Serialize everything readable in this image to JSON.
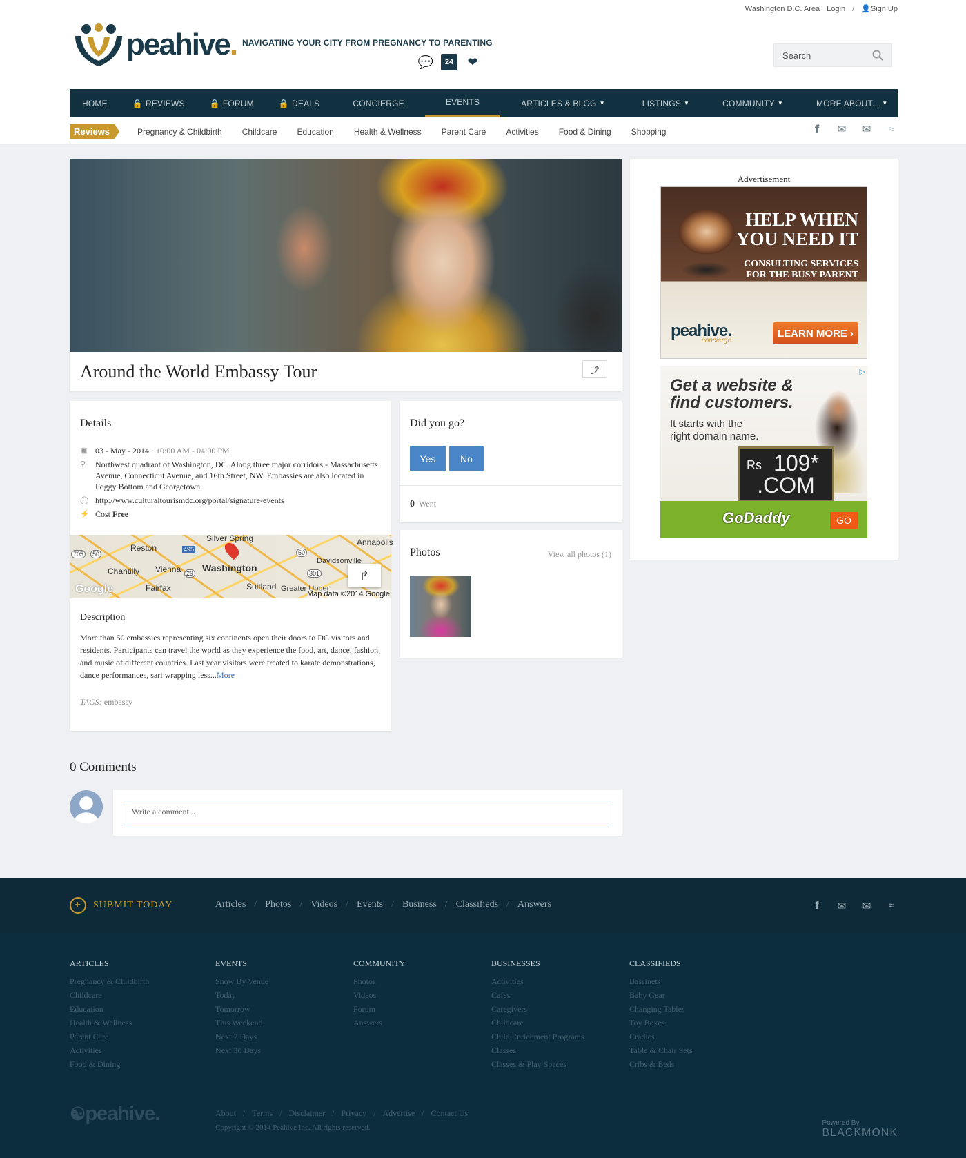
{
  "topbar": {
    "region": "Washington D.C. Area",
    "login": "Login",
    "separator": "/",
    "signup": "Sign Up"
  },
  "brand": {
    "name": "peahive",
    "dot": ".",
    "tagline": "NAVIGATING YOUR CITY FROM PREGNANCY TO PARENTING",
    "calendar_day": "24"
  },
  "search": {
    "placeholder": "Search"
  },
  "nav": {
    "home": "HOME",
    "reviews": "REVIEWS",
    "forum": "FORUM",
    "deals": "DEALS",
    "concierge": "CONCIERGE",
    "events": "EVENTS",
    "articles": "ARTICLES & BLOG",
    "listings": "LISTINGS",
    "community": "COMMUNITY",
    "more": "MORE ABOUT..."
  },
  "subnav": {
    "badge": "Reviews",
    "items": [
      "Pregnancy & Childbirth",
      "Childcare",
      "Education",
      "Health & Wellness",
      "Parent Care",
      "Activities",
      "Food & Dining",
      "Shopping"
    ]
  },
  "event": {
    "title": "Around the World Embassy Tour",
    "details_heading": "Details",
    "date": "03 - May - 2014",
    "date_sep": "·",
    "time": "10:00 AM - 04:00 PM",
    "location": "Northwest quadrant of Washington, DC. Along three major corridors - Massachusetts Avenue, Connecticut Avenue, and 16th Street, NW. Embassies are also located in Foggy Bottom and Georgetown",
    "url": "http://www.culturaltourismdc.org/portal/signature-events",
    "cost_label": "Cost",
    "cost_value": "Free",
    "description_heading": "Description",
    "description": "More than 50 embassies representing six continents open their doors to DC visitors and residents. Participants can travel the world as they experience the food, art, dance, fashion, and music of different countries. Last year visitors were treated to karate demonstrations, dance performances, sari wrapping less...",
    "more_link": "More",
    "tags_label": "TAGS:",
    "tags": "embassy"
  },
  "map": {
    "labels": [
      "Silver Spring",
      "Reston",
      "Chantilly",
      "Vienna",
      "Washington",
      "Fairfax",
      "Suitland",
      "Annapolis",
      "Davidsonville",
      "Greater Upper",
      "495",
      "50",
      "29",
      "50",
      "301",
      "705"
    ],
    "attribution": "Map data ©2014 Google",
    "logo": "Google"
  },
  "attendance": {
    "heading": "Did you go?",
    "yes": "Yes",
    "no": "No",
    "count": "0",
    "went_label": "Went"
  },
  "photos": {
    "heading": "Photos",
    "view_all": "View all photos (1)"
  },
  "ads": {
    "label": "Advertisement",
    "ad1": {
      "headline_1": "HELP WHEN",
      "headline_2": "YOU NEED IT",
      "sub_1": "CONSULTING SERVICES",
      "sub_2": "FOR THE BUSY PARENT",
      "brand": "peahive.",
      "brand_sub": "concierge",
      "cta": "LEARN MORE ›"
    },
    "ad2": {
      "headline_1": "Get a website &",
      "headline_2": "find customers.",
      "sub_1": "It starts with the",
      "sub_2": "right domain name.",
      "currency": "Rs",
      "price": "109*",
      "tld": ".COM",
      "brand": "GoDaddy",
      "cta": "GO"
    }
  },
  "comments": {
    "heading": "0 Comments",
    "placeholder": "Write a comment..."
  },
  "footer": {
    "submit": "SUBMIT TODAY",
    "links": [
      "Articles",
      "Photos",
      "Videos",
      "Events",
      "Business",
      "Classifieds",
      "Answers"
    ],
    "columns": [
      {
        "title": "ARTICLES",
        "items": [
          "Pregnancy & Childbirth",
          "Childcare",
          "Education",
          "Health & Wellness",
          "Parent Care",
          "Activities",
          "Food & Dining"
        ]
      },
      {
        "title": "EVENTS",
        "items": [
          "Show By Venue",
          "Today",
          "Tomorrow",
          "This Weekend",
          "Next 7 Days",
          "Next 30 Days"
        ]
      },
      {
        "title": "COMMUNITY",
        "items": [
          "Photos",
          "Videos",
          "Forum",
          "Answers"
        ]
      },
      {
        "title": "BUSINESSES",
        "items": [
          "Activities",
          "Cafes",
          "Caregivers",
          "Childcare",
          "Child Enrichment Programs",
          "Classes",
          "Classes & Play Spaces"
        ]
      },
      {
        "title": "CLASSIFIEDS",
        "items": [
          "Bassinets",
          "Baby Gear",
          "Changing Tables",
          "Toy Boxes",
          "Cradles",
          "Table & Chair Sets",
          "Cribs & Beds"
        ]
      }
    ],
    "brand": "peahive.",
    "bottom_links": [
      "About",
      "Terms",
      "Disclaimer",
      "Privacy",
      "Advertise",
      "Contact Us"
    ],
    "copyright": "Copyright © 2014 Peahive Inc. All rights reserved.",
    "powered_by": "Powered By",
    "powered_brand": "BLACKMONK"
  }
}
